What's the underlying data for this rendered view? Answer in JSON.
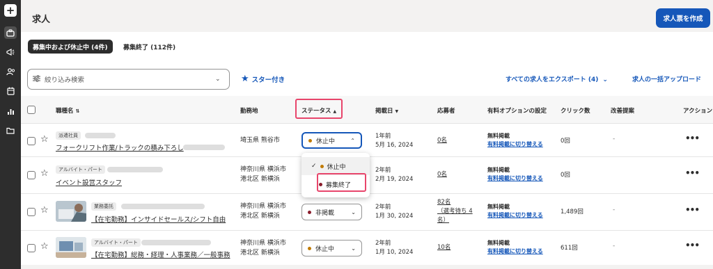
{
  "header": {
    "title": "求人",
    "create_button": "求人票を作成"
  },
  "tabs": [
    {
      "label": "募集中および休止中 (4件)"
    },
    {
      "label": "募集終了 (112件)"
    }
  ],
  "toolbar": {
    "search_placeholder": "絞り込み検索",
    "starred": "スター付き",
    "export": "すべての求人をエクスポート (4)",
    "bulk_upload": "求人の一括アップロード"
  },
  "columns": {
    "job_title": "職種名",
    "location": "勤務地",
    "status": "ステータス",
    "posted": "掲載日",
    "applicants": "応募者",
    "options": "有料オプションの設定",
    "clicks": "クリック数",
    "suggestions": "改善提案",
    "actions": "アクション"
  },
  "rows": [
    {
      "badge": "派遣社員",
      "title": "フォークリフト作業/トラックの積み下ろし",
      "location_line1": "埼玉県 熊谷市",
      "location_line2": "",
      "status": "休止中",
      "status_color": "#c07a00",
      "posted_line1": "1年前",
      "posted_line2": "5月 16, 2024",
      "applicants_line1": "0名",
      "applicants_line2": "",
      "applicants_line3": "",
      "option_label": "無料掲載",
      "option_link": "有料掲載に切り替える",
      "clicks": "0回",
      "suggestion": "-"
    },
    {
      "badge": "アルバイト・パート",
      "title": "イベント設営スタッフ",
      "location_line1": "神奈川県 横浜市",
      "location_line2": "港北区 新横浜",
      "status": "",
      "status_color": "",
      "posted_line1": "2年前",
      "posted_line2": "2月 19, 2024",
      "applicants_line1": "0名",
      "applicants_line2": "",
      "applicants_line3": "",
      "option_label": "無料掲載",
      "option_link": "有料掲載に切り替える",
      "clicks": "0回",
      "suggestion": ""
    },
    {
      "badge": "業務委託",
      "title": "【在宅勤務】インサイドセールス/シフト自由",
      "location_line1": "神奈川県 横浜市",
      "location_line2": "港北区 新横浜",
      "status": "非掲載",
      "status_color": "#8a1c2b",
      "posted_line1": "2年前",
      "posted_line2": "1月 30, 2024",
      "applicants_line1": "82名",
      "applicants_line2": "（選考待ち 4",
      "applicants_line3": "名）",
      "option_label": "無料掲載",
      "option_link": "有料掲載に切り替える",
      "clicks": "1,489回",
      "suggestion": "-"
    },
    {
      "badge": "アルバイト・パート",
      "title": "【在宅勤務】総務・経理・人事業務／一般事務",
      "location_line1": "神奈川県 横浜市",
      "location_line2": "港北区 新横浜",
      "status": "休止中",
      "status_color": "#c07a00",
      "posted_line1": "2年前",
      "posted_line2": "1月 10, 2024",
      "applicants_line1": "10名",
      "applicants_line2": "",
      "applicants_line3": "",
      "option_label": "無料掲載",
      "option_link": "有料掲載に切り替える",
      "clicks": "611回",
      "suggestion": "-"
    }
  ],
  "dropdown": {
    "items": [
      {
        "label": "休止中",
        "color": "#c07a00",
        "checked": true
      },
      {
        "label": "募集終了",
        "color": "#8a1c2b",
        "checked": false
      }
    ]
  },
  "icons": {
    "plus": "+",
    "star": "☆",
    "star_filled": "★",
    "more": "•••",
    "chevron_down": "⌄",
    "check": "✓",
    "sort_up": "▲",
    "sort_down": "▼"
  }
}
